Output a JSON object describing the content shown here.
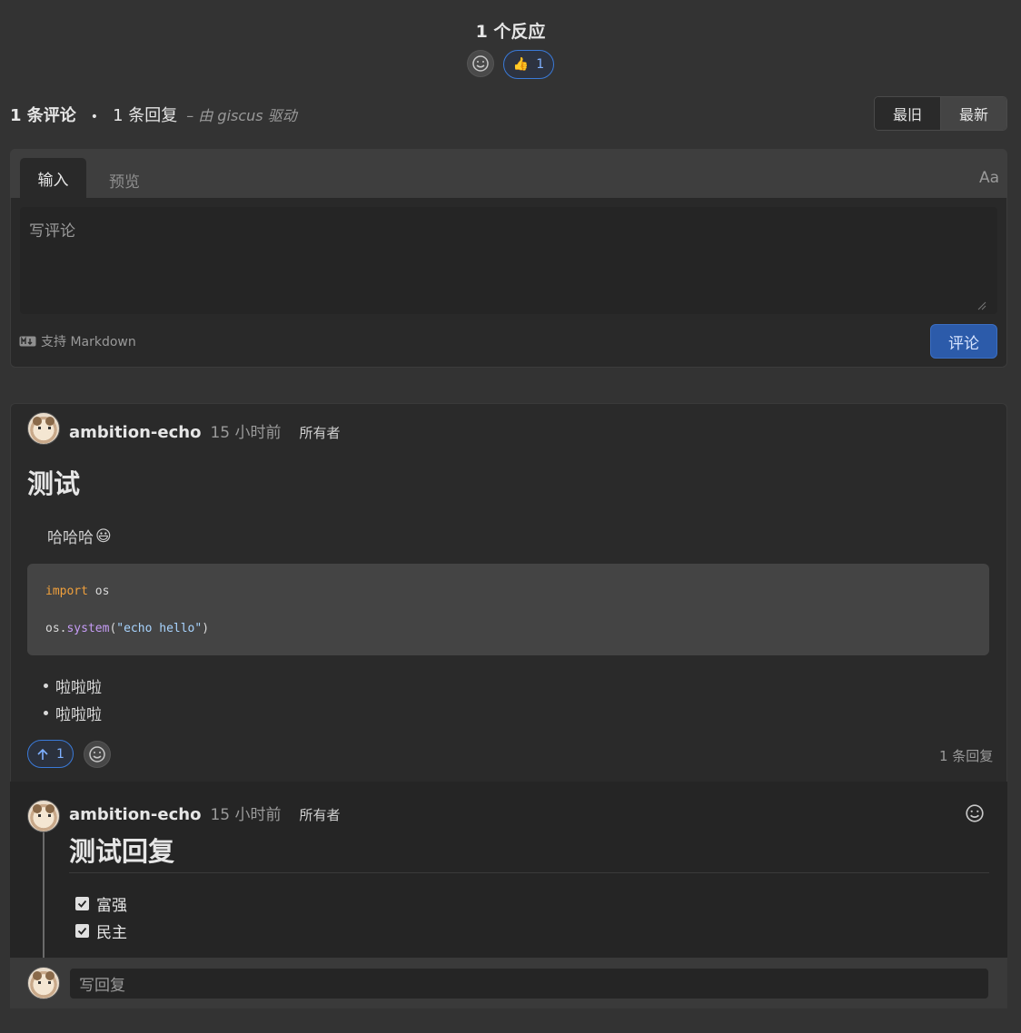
{
  "reactions": {
    "title": "1 个反应",
    "thumbs": {
      "emoji": "👍",
      "count": "1"
    }
  },
  "summary": {
    "comments": "1 条评论",
    "separator": "•",
    "replies": "1 条回复",
    "powered_by": "– 由 giscus 驱动"
  },
  "sort": {
    "oldest": "最旧",
    "newest": "最新",
    "selected": "最新"
  },
  "editor": {
    "tab_input": "输入",
    "tab_preview": "预览",
    "font_toggle": "Aa",
    "placeholder": "写评论",
    "markdown_note": "支持 Markdown",
    "submit": "评论"
  },
  "comment": {
    "author": "ambition-echo",
    "time": "15 小时前",
    "role": "所有者",
    "heading": "测试",
    "paragraph": "哈哈哈",
    "paragraph_emoji": "😃",
    "code": {
      "line1_kw": "import",
      "line1_rest": " os",
      "line2_obj": "os.",
      "line2_fn": "system",
      "line2_open": "(",
      "line2_str": "\"echo hello\"",
      "line2_close": ")"
    },
    "list": [
      "啦啦啦",
      "啦啦啦"
    ],
    "upvotes": "1",
    "reply_count": "1 条回复"
  },
  "reply": {
    "author": "ambition-echo",
    "time": "15 小时前",
    "role": "所有者",
    "heading": "测试回复",
    "checklist": [
      {
        "label": "富强",
        "checked": true
      },
      {
        "label": "民主",
        "checked": true
      }
    ],
    "input_placeholder": "写回复"
  },
  "colors": {
    "accent": "#3a7ad9",
    "submit": "#2c5baa",
    "background": "#333333"
  }
}
